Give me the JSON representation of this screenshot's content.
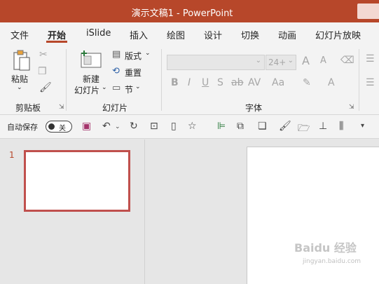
{
  "window": {
    "title": "演示文稿1  -  PowerPoint"
  },
  "tabs": [
    "文件",
    "开始",
    "iSlide",
    "插入",
    "绘图",
    "设计",
    "切换",
    "动画",
    "幻灯片放映"
  ],
  "active_tab": "开始",
  "clipboard": {
    "paste_label": "粘贴",
    "group_label": "剪贴板"
  },
  "slides": {
    "new_slide_line1": "新建",
    "new_slide_line2": "幻灯片",
    "layout_label": "版式",
    "reset_label": "重置",
    "section_label": "节",
    "group_label": "幻灯片"
  },
  "font": {
    "font_name_value": "",
    "font_size_value": "24+",
    "grow_label": "A",
    "shrink_label": "A",
    "bold": "B",
    "italic": "I",
    "underline": "U",
    "shadow": "S",
    "strike": "ab",
    "spacing": "AV",
    "case": "Aa",
    "group_label": "字体"
  },
  "qat": {
    "autosave_label": "自动保存",
    "toggle_label": "关"
  },
  "thumbnails": {
    "slide_number": "1"
  },
  "watermark": {
    "brand": "Baidu 经验",
    "url": "jingyan.baidu.com"
  },
  "colors": {
    "accent": "#b7472a",
    "thumb_border": "#c0504d"
  }
}
